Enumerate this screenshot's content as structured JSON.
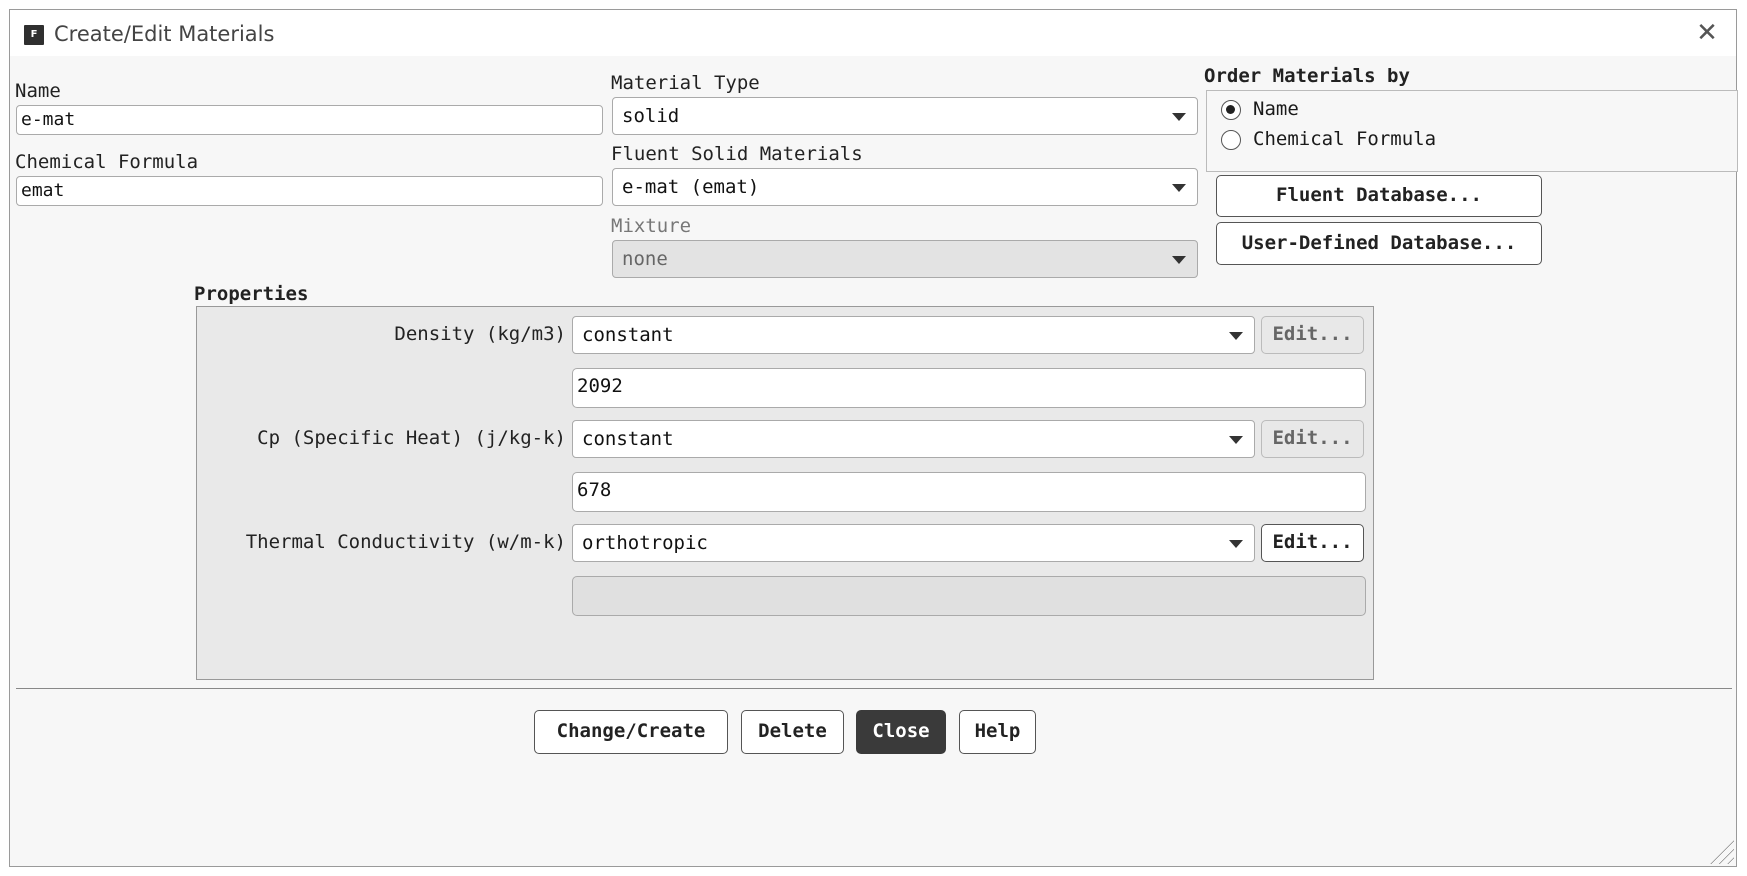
{
  "window": {
    "title": "Create/Edit Materials",
    "icon": "F"
  },
  "name": {
    "label": "Name",
    "value": "e-mat"
  },
  "chemical_formula": {
    "label": "Chemical Formula",
    "value": "emat"
  },
  "material_type": {
    "label": "Material Type",
    "value": "solid"
  },
  "fluent_solid_materials": {
    "label": "Fluent Solid Materials",
    "value": "e-mat (emat)"
  },
  "mixture": {
    "label": "Mixture",
    "value": "none"
  },
  "order_by": {
    "label": "Order Materials by",
    "options": [
      "Name",
      "Chemical Formula"
    ],
    "selected": "Name"
  },
  "database_buttons": {
    "fluent": "Fluent Database...",
    "user_defined": "User-Defined Database..."
  },
  "properties": {
    "label": "Properties",
    "rows": [
      {
        "label": "Density (kg/m3)",
        "method": "constant",
        "value": "2092",
        "edit": "Edit..."
      },
      {
        "label": "Cp (Specific Heat) (j/kg-k)",
        "method": "constant",
        "value": "678",
        "edit": "Edit..."
      },
      {
        "label": "Thermal Conductivity (w/m-k)",
        "method": "orthotropic",
        "value": "",
        "edit": "Edit..."
      }
    ]
  },
  "footer": {
    "change_create": "Change/Create",
    "delete": "Delete",
    "close": "Close",
    "help": "Help"
  },
  "icons": {
    "app": "fluent-app-icon",
    "close": "close-icon",
    "dropdown": "chevron-down-icon",
    "resize": "resize-grip-icon"
  }
}
